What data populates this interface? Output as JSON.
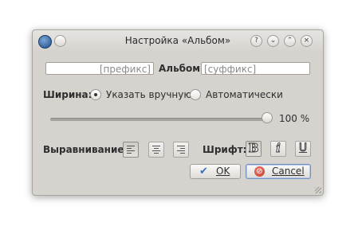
{
  "window": {
    "title": "Настройка «Альбом»"
  },
  "titlebar": {
    "help": "?",
    "minimize": "⌄",
    "maximize": "⌃",
    "close": "×"
  },
  "tag": {
    "prefix_placeholder": "[префикс]",
    "name": "Альбом",
    "suffix_placeholder": "[суффикс]"
  },
  "width": {
    "label": "Ширина:",
    "manual_label": "Указать вручную",
    "auto_label": "Автоматически",
    "selected": "manual",
    "value_text": "100 %",
    "slider_value": 1.0
  },
  "align": {
    "label": "Выравнивание:"
  },
  "font": {
    "label": "Шрифт:",
    "bold_glyph": "B",
    "italic_glyph": "i",
    "underline_glyph": "U"
  },
  "buttons": {
    "ok_label": "OK",
    "cancel_label": "Cancel"
  },
  "colors": {
    "ok_check": "#3a6fb5",
    "cancel_icon": "#c0392b"
  }
}
